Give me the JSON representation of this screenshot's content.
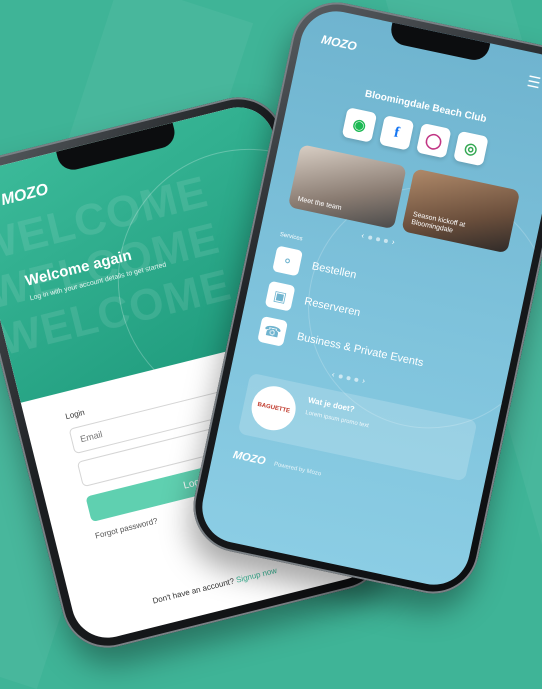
{
  "colors": {
    "background": "#3fb497",
    "accent": "#3cbb9a",
    "right_screen": "#7fc3dc"
  },
  "left_phone": {
    "logo": "MOZO",
    "watermark": "WELCOME",
    "heading": "Welcome again",
    "subtext": "Log in with your account details to get started",
    "login_label": "Login",
    "email_placeholder": "Email",
    "password_placeholder": "",
    "submit_label": "Login",
    "forgot_label": "Forgot password?",
    "signup_prompt": "Don't have an account?",
    "signup_link": "Signup now"
  },
  "right_phone": {
    "logo": "MOZO",
    "venue_title": "Bloomingdale Beach Club",
    "social_icons": [
      "spotify-icon",
      "facebook-icon",
      "instagram-icon",
      "tripadvisor-icon"
    ],
    "photos": [
      {
        "caption": "Meet the team"
      },
      {
        "caption": "Season kickoff at Bloomingdale"
      }
    ],
    "services_header": "Services",
    "services": [
      {
        "label": "Bestellen",
        "icon": "cutlery-icon"
      },
      {
        "label": "Reserveren",
        "icon": "calendar-icon"
      },
      {
        "label": "Business & Private Events",
        "icon": "megaphone-icon"
      }
    ],
    "promo_logo": "BAGUETTE",
    "promo_title": "Wat je doet?",
    "promo_text": "Lorem ipsum promo text",
    "footer_logo": "MOZO",
    "footer_text": "Powered by Mozo"
  }
}
